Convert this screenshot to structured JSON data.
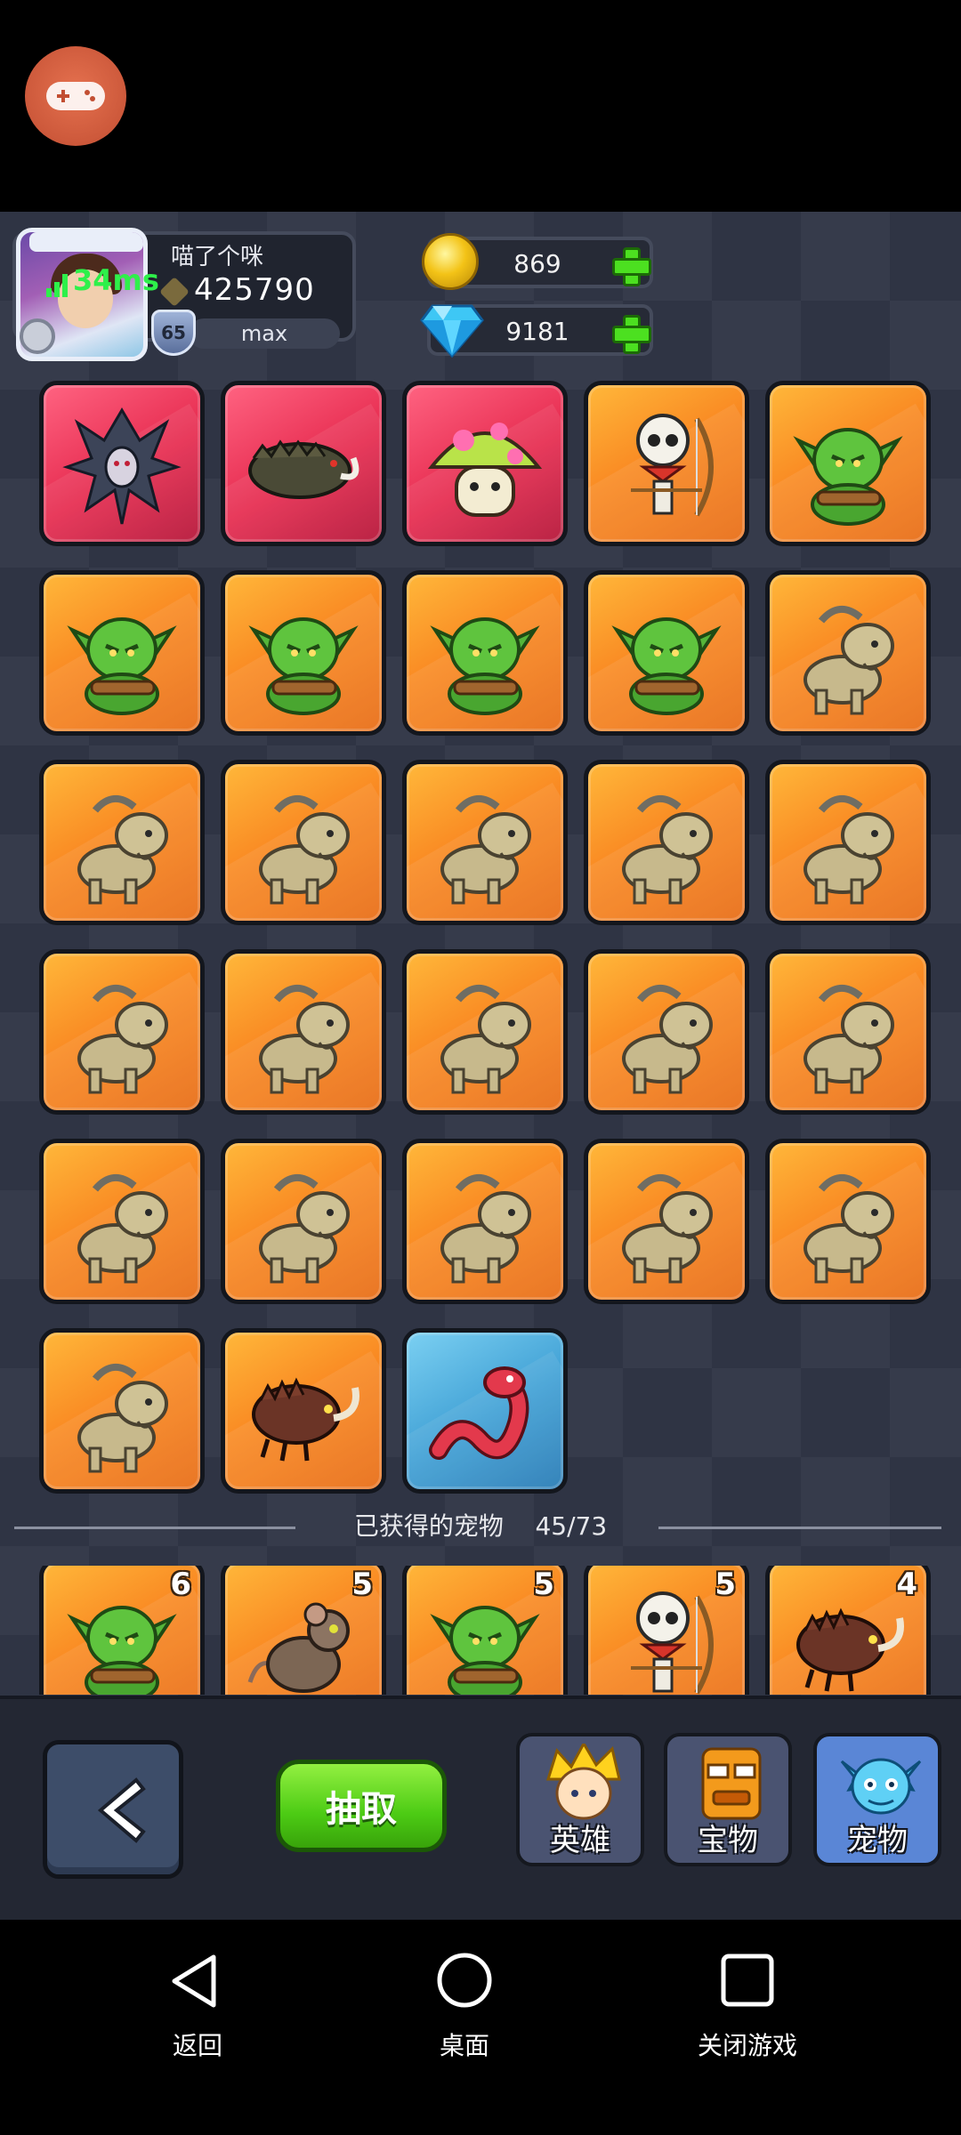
{
  "player": {
    "name": "喵了个咪",
    "score": "425790",
    "level": "65",
    "level_status": "max",
    "ping": "34ms"
  },
  "currency": {
    "gold": "869",
    "gems": "9181"
  },
  "pets": [
    {
      "kind": "harpy",
      "rarity": "red"
    },
    {
      "kind": "boar",
      "rarity": "red"
    },
    {
      "kind": "mushroom",
      "rarity": "red"
    },
    {
      "kind": "skeleton-archer",
      "rarity": "orange"
    },
    {
      "kind": "goblin",
      "rarity": "orange"
    },
    {
      "kind": "goblin",
      "rarity": "orange"
    },
    {
      "kind": "goblin",
      "rarity": "orange"
    },
    {
      "kind": "goblin",
      "rarity": "orange"
    },
    {
      "kind": "goblin",
      "rarity": "orange"
    },
    {
      "kind": "goat",
      "rarity": "orange"
    },
    {
      "kind": "goat",
      "rarity": "orange"
    },
    {
      "kind": "goat",
      "rarity": "orange"
    },
    {
      "kind": "goat",
      "rarity": "orange"
    },
    {
      "kind": "goat",
      "rarity": "orange"
    },
    {
      "kind": "goat",
      "rarity": "orange"
    },
    {
      "kind": "goat",
      "rarity": "orange"
    },
    {
      "kind": "goat",
      "rarity": "orange"
    },
    {
      "kind": "goat",
      "rarity": "orange"
    },
    {
      "kind": "goat",
      "rarity": "orange"
    },
    {
      "kind": "goat",
      "rarity": "orange"
    },
    {
      "kind": "goat",
      "rarity": "orange"
    },
    {
      "kind": "goat",
      "rarity": "orange"
    },
    {
      "kind": "goat",
      "rarity": "orange"
    },
    {
      "kind": "goat",
      "rarity": "orange"
    },
    {
      "kind": "goat",
      "rarity": "orange"
    },
    {
      "kind": "goat",
      "rarity": "orange"
    },
    {
      "kind": "beetle",
      "rarity": "orange"
    },
    {
      "kind": "worm",
      "rarity": "blue"
    }
  ],
  "owned_section": {
    "label": "已获得的宠物",
    "count": "45/73",
    "items": [
      {
        "kind": "goblin",
        "rarity": "orange",
        "count": "6"
      },
      {
        "kind": "rat",
        "rarity": "orange",
        "count": "5"
      },
      {
        "kind": "goblin",
        "rarity": "orange",
        "count": "5"
      },
      {
        "kind": "skeleton-archer",
        "rarity": "orange",
        "count": "5"
      },
      {
        "kind": "beetle",
        "rarity": "orange",
        "count": "4"
      }
    ]
  },
  "toolbar": {
    "draw_label": "抽取",
    "tab_hero": "英雄",
    "tab_treasure": "宝物",
    "tab_pet": "宠物"
  },
  "navbar": {
    "back": "返回",
    "home": "桌面",
    "close_game": "关闭游戏"
  },
  "colors": {
    "tile_orange": "#f98a23",
    "tile_red": "#e62b4f",
    "tile_blue": "#3f9fd4",
    "accent_green": "#4ce020",
    "ping_green": "#2ef04a"
  }
}
